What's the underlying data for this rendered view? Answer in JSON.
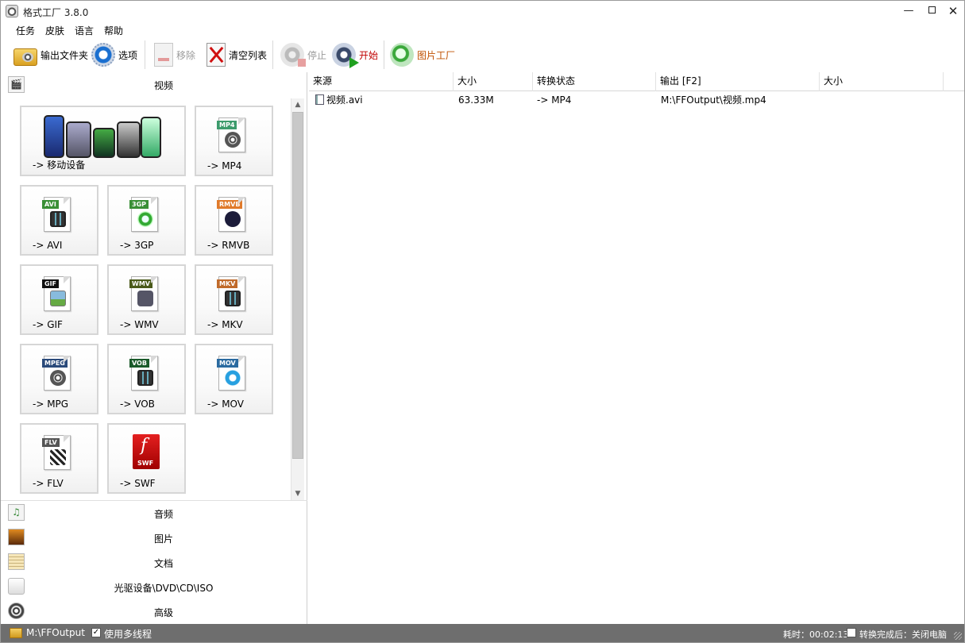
{
  "window": {
    "title": "格式工厂 3.8.0"
  },
  "menu": [
    "任务",
    "皮肤",
    "语言",
    "帮助"
  ],
  "toolbar": {
    "output_folder": "输出文件夹",
    "options": "选项",
    "remove": "移除",
    "clear_list": "清空列表",
    "stop": "停止",
    "start": "开始",
    "picture_factory": "图片工厂"
  },
  "left_panel": {
    "video_category": "视频",
    "tiles": [
      {
        "label": "-> 移动设备",
        "icon": "mobile-devices-icon"
      },
      {
        "label": "-> MP4",
        "badge": "MP4",
        "badge_color": "#3c9b6c",
        "icon": "mp4-file-icon"
      },
      {
        "label": "-> AVI",
        "badge": "AVI",
        "badge_color": "#3a8f36",
        "icon": "avi-file-icon"
      },
      {
        "label": "-> 3GP",
        "badge": "3GP",
        "badge_color": "#3a8f36",
        "icon": "3gp-file-icon"
      },
      {
        "label": "-> RMVB",
        "badge": "RMVB",
        "badge_color": "#e07a2a",
        "icon": "rmvb-file-icon"
      },
      {
        "label": "-> GIF",
        "badge": "GIF",
        "badge_color": "#111111",
        "icon": "gif-file-icon"
      },
      {
        "label": "-> WMV",
        "badge": "WMV",
        "badge_color": "#4a5a1a",
        "icon": "wmv-file-icon"
      },
      {
        "label": "-> MKV",
        "badge": "MKV",
        "badge_color": "#c06a2a",
        "icon": "mkv-file-icon"
      },
      {
        "label": "-> MPG",
        "badge": "MPEG",
        "badge_color": "#2a4a7a",
        "icon": "mpg-file-icon"
      },
      {
        "label": "-> VOB",
        "badge": "VOB",
        "badge_color": "#1a5a2a",
        "icon": "vob-file-icon"
      },
      {
        "label": "-> MOV",
        "badge": "MOV",
        "badge_color": "#2a6aa0",
        "icon": "mov-file-icon"
      },
      {
        "label": "-> FLV",
        "badge": "FLV",
        "badge_color": "#555555",
        "icon": "flv-file-icon"
      },
      {
        "label": "-> SWF",
        "badge": "SWF",
        "badge_color": "#c00000",
        "icon": "swf-file-icon"
      }
    ],
    "categories": [
      "音频",
      "图片",
      "文档",
      "光驱设备\\DVD\\CD\\ISO",
      "高级"
    ]
  },
  "table": {
    "headers": [
      "来源",
      "大小",
      "转换状态",
      "输出 [F2]",
      "大小"
    ],
    "rows": [
      {
        "source": "视频.avi",
        "size": "63.33M",
        "status": "-> MP4",
        "output": "M:\\FFOutput\\视频.mp4",
        "out_size": ""
      }
    ]
  },
  "statusbar": {
    "output_path": "M:\\FFOutput",
    "multithread_label": "使用多线程",
    "multithread_checked": "✓",
    "elapsed": "耗时：00:02:13",
    "after_convert": "转换完成后：关闭电脑"
  }
}
